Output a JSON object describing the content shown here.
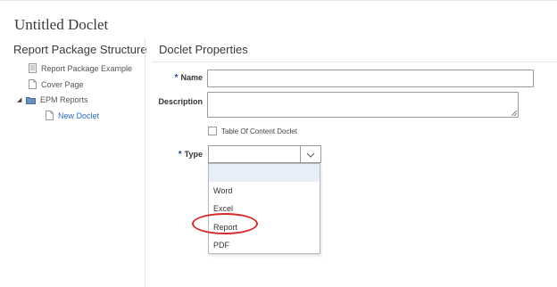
{
  "page": {
    "title": "Untitled Doclet"
  },
  "tree": {
    "title": "Report Package Structure",
    "items": [
      {
        "label": "Report Package Example",
        "icon": "report-package-icon"
      },
      {
        "label": "Cover Page",
        "icon": "document-icon"
      },
      {
        "label": "EPM Reports",
        "icon": "folder-icon",
        "expanded": true
      },
      {
        "label": "New Doclet",
        "icon": "document-icon",
        "selected": true
      }
    ]
  },
  "properties": {
    "title": "Doclet Properties",
    "required_marker": "*",
    "name": {
      "label": "Name",
      "value": ""
    },
    "description": {
      "label": "Description",
      "value": ""
    },
    "toc_checkbox": {
      "label": "Table Of Content Doclet",
      "checked": false
    },
    "type": {
      "label": "Type",
      "value": "",
      "options": [
        "",
        "Word",
        "Excel",
        "Report",
        "PDF"
      ],
      "highlighted_option": "Report"
    }
  },
  "colors": {
    "selected_link": "#2b6cc4",
    "required_marker": "#1a4d99",
    "annotation": "#d62a2a",
    "dropdown_hover": "#e8eef8"
  }
}
